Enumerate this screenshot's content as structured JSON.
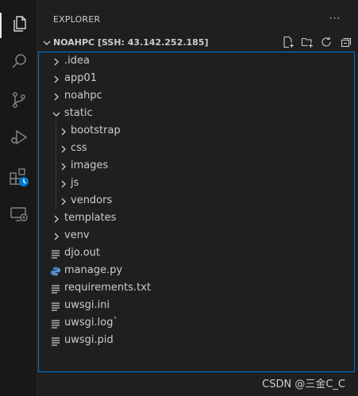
{
  "sidebar": {
    "title": "EXPLORER",
    "more_label": "···",
    "section_title": "NOAHPC [SSH: 43.142.252.185]"
  },
  "activity_bar": {
    "items": [
      "files-icon",
      "search-icon",
      "source-control-icon",
      "run-debug-icon",
      "extensions-icon",
      "remote-explorer-icon"
    ]
  },
  "tree": {
    "root": [
      ".idea",
      "app01",
      "noahpc",
      "static",
      "templates",
      "venv"
    ],
    "static_children": [
      "bootstrap",
      "css",
      "images",
      "js",
      "vendors"
    ],
    "files": [
      "djo.out",
      "manage.py",
      "requirements.txt",
      "uwsgi.ini",
      "uwsgi.log`",
      "uwsgi.pid"
    ]
  },
  "watermark": "CSDN @三金C_C",
  "colors": {
    "accent": "#0078d4",
    "python_icon": "#3f7fbf",
    "badge": "#0078d4"
  }
}
